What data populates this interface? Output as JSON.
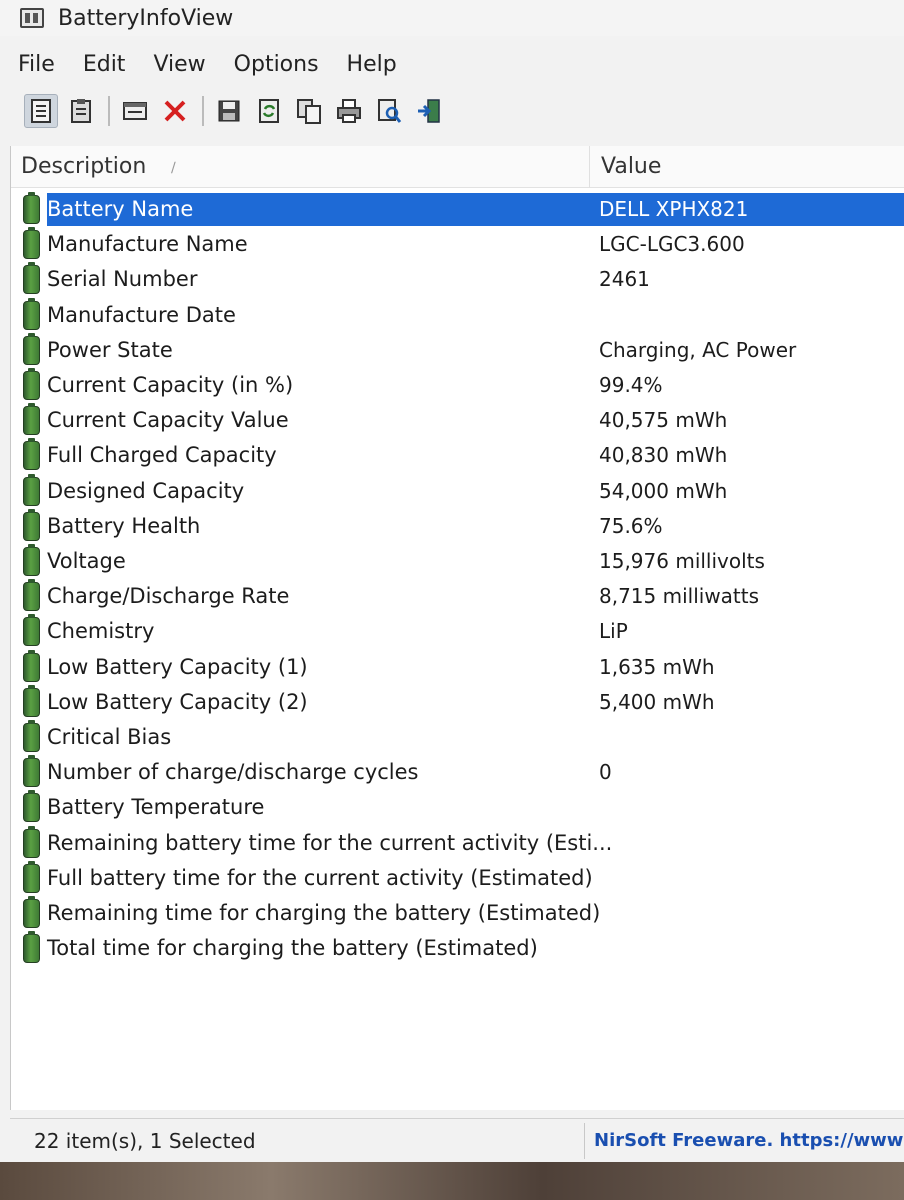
{
  "window": {
    "title": "BatteryInfoView"
  },
  "menu": [
    "File",
    "Edit",
    "View",
    "Options",
    "Help"
  ],
  "toolbar": {
    "icons": [
      "html-report-icon",
      "properties-icon",
      "options-icon",
      "delete-icon",
      "save-icon",
      "refresh-icon",
      "copy-icon",
      "print-icon",
      "find-icon",
      "exit-icon"
    ]
  },
  "columns": {
    "description": "Description",
    "value": "Value"
  },
  "rows": [
    {
      "desc": "Battery Name",
      "val": "DELL XPHX821",
      "selected": true
    },
    {
      "desc": "Manufacture Name",
      "val": "LGC-LGC3.600"
    },
    {
      "desc": "Serial Number",
      "val": "2461"
    },
    {
      "desc": "Manufacture Date",
      "val": ""
    },
    {
      "desc": "Power State",
      "val": "Charging, AC Power"
    },
    {
      "desc": "Current Capacity (in %)",
      "val": "99.4%"
    },
    {
      "desc": "Current Capacity Value",
      "val": "40,575 mWh"
    },
    {
      "desc": "Full Charged Capacity",
      "val": "40,830 mWh"
    },
    {
      "desc": "Designed Capacity",
      "val": "54,000 mWh"
    },
    {
      "desc": "Battery Health",
      "val": "75.6%"
    },
    {
      "desc": "Voltage",
      "val": "15,976 millivolts"
    },
    {
      "desc": "Charge/Discharge Rate",
      "val": "8,715 milliwatts"
    },
    {
      "desc": "Chemistry",
      "val": "LiP"
    },
    {
      "desc": "Low Battery Capacity (1)",
      "val": "1,635 mWh"
    },
    {
      "desc": "Low Battery Capacity (2)",
      "val": "5,400 mWh"
    },
    {
      "desc": "Critical Bias",
      "val": ""
    },
    {
      "desc": "Number of charge/discharge cycles",
      "val": "0"
    },
    {
      "desc": "Battery Temperature",
      "val": ""
    },
    {
      "desc": "Remaining battery time for the current activity (Esti...",
      "val": ""
    },
    {
      "desc": "Full battery time for the current activity (Estimated)",
      "val": ""
    },
    {
      "desc": "Remaining time for charging the battery (Estimated)",
      "val": ""
    },
    {
      "desc": "Total  time for charging the battery (Estimated)",
      "val": ""
    }
  ],
  "status": {
    "count": "22 item(s), 1 Selected",
    "credit": "NirSoft Freeware. https://www."
  },
  "colors": {
    "selection": "#1e6ad6",
    "link": "#1a4fb0"
  }
}
